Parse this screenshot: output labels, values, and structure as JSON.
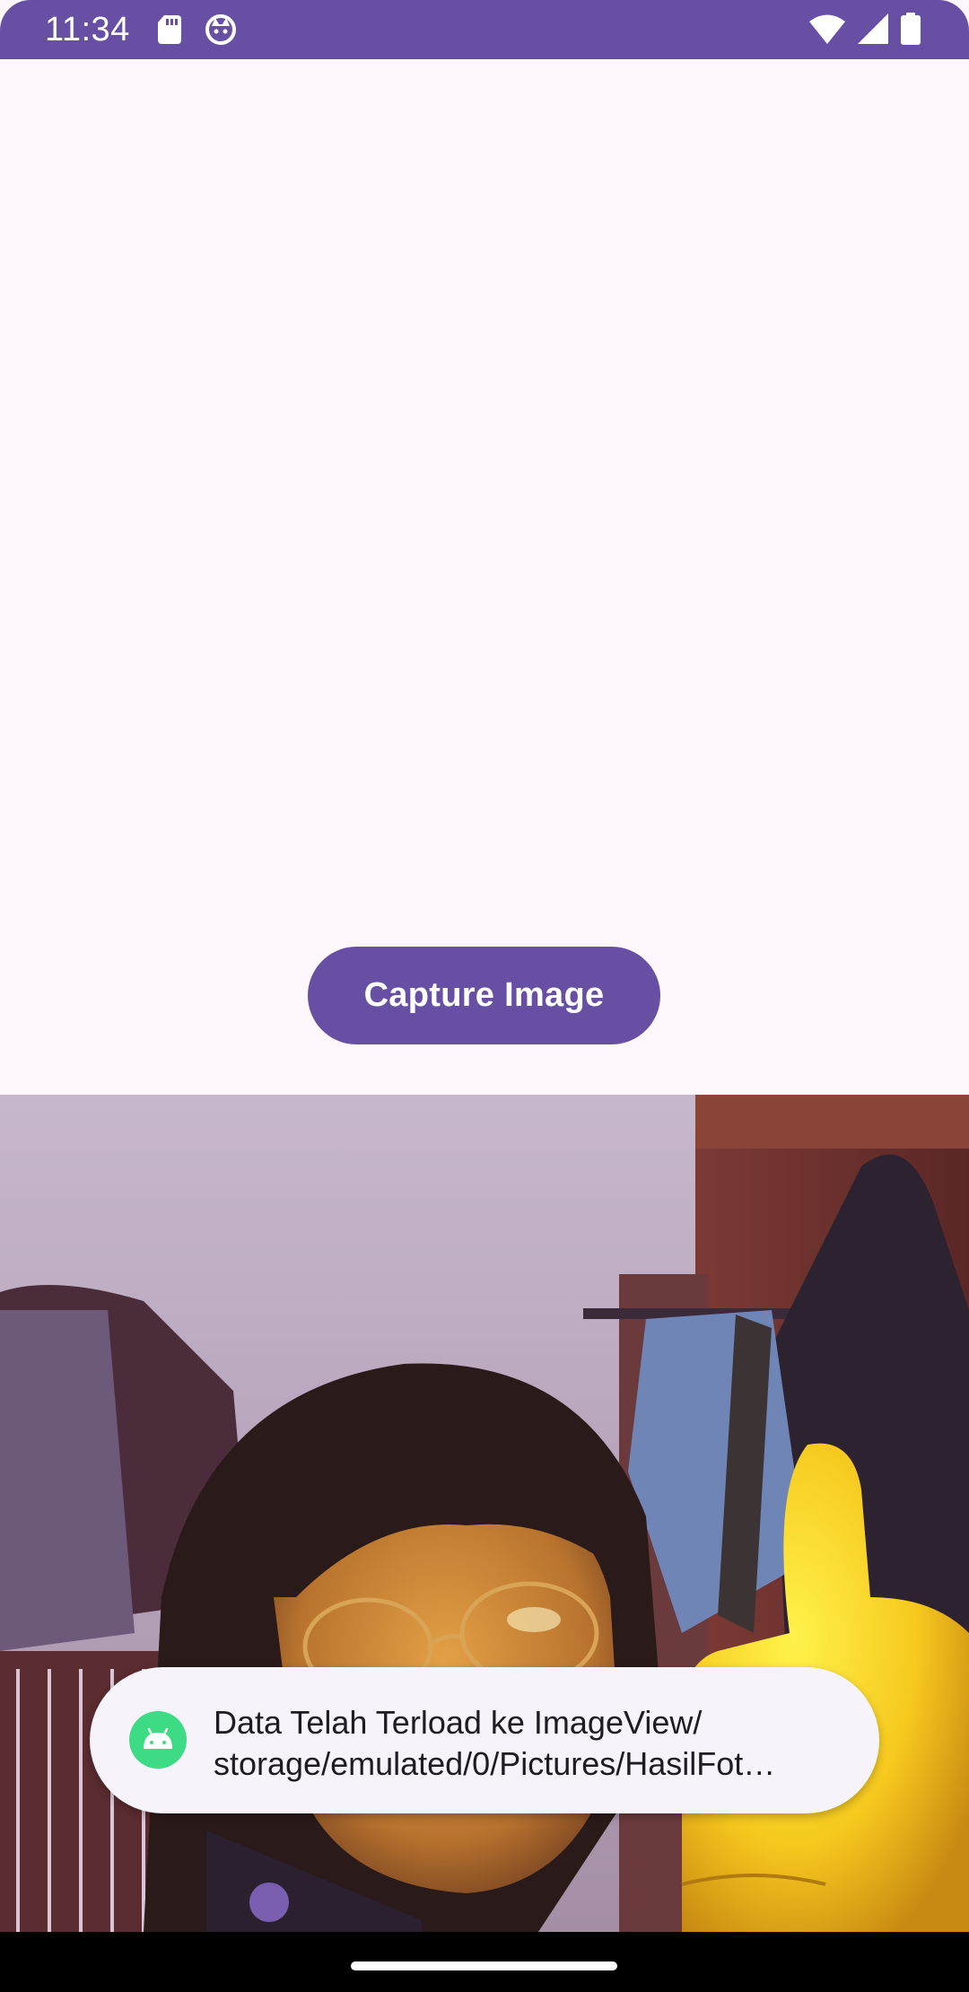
{
  "status_bar": {
    "time": "11:34",
    "background_color": "#6750a4",
    "left_icons": [
      "sd-card-icon",
      "notification-app-icon"
    ],
    "right_icons": [
      "wifi-icon",
      "cellular-signal-icon",
      "battery-icon"
    ]
  },
  "main": {
    "capture_button_label": "Capture Image",
    "accent_color": "#6750a4",
    "image_view": {
      "content": "captured-camera-photo"
    }
  },
  "toast": {
    "icon": "android-icon",
    "line1": "Data Telah Terload ke ImageView/",
    "line2": "storage/emulated/0/Pictures/HasilFot…"
  },
  "nav_bar": {
    "handle": "gesture-navigation-handle"
  }
}
